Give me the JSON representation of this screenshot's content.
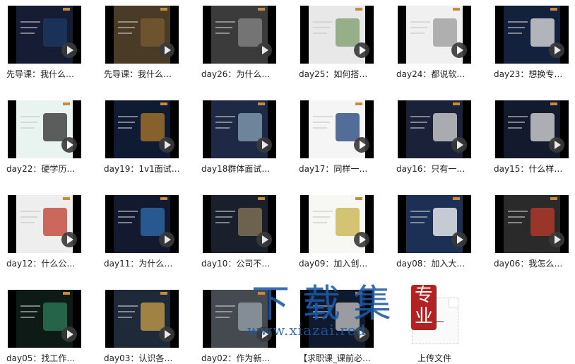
{
  "tiles": [
    {
      "caption": "先导课：我什么…",
      "bg": "#151c33",
      "accent": "#1c3a66"
    },
    {
      "caption": "先导课：我什么…",
      "bg": "#4a3b26",
      "accent": "#7a5c32"
    },
    {
      "caption": "day26：为什么…",
      "bg": "#3b3b3b",
      "accent": "#888888"
    },
    {
      "caption": "day25：如何搭…",
      "bg": "#e8e8e8",
      "accent": "#7b9c6a"
    },
    {
      "caption": "day24：都说软…",
      "bg": "#f0f0f0",
      "accent": "#999999"
    },
    {
      "caption": "day23：想换专…",
      "bg": "#14213d",
      "accent": "#e5e5e5"
    },
    {
      "caption": "day22：硬学历…",
      "bg": "#e9f3f0",
      "accent": "#2b2b2b"
    },
    {
      "caption": "day19：1v1面试…",
      "bg": "#0f1a33",
      "accent": "#b07a2a"
    },
    {
      "caption": "day18群体面试…",
      "bg": "#1e2a45",
      "accent": "#8aa3b8"
    },
    {
      "caption": "day17：同样一…",
      "bg": "#f5f5f5",
      "accent": "#1c3f7a"
    },
    {
      "caption": "day16：只有一…",
      "bg": "#1a2138",
      "accent": "#d9d9d9"
    },
    {
      "caption": "day15：什么样…",
      "bg": "#141a2e",
      "accent": "#e0e0e0"
    },
    {
      "caption": "day12：什么公…",
      "bg": "#eeeeee",
      "accent": "#c0392b"
    },
    {
      "caption": "day11：为什么…",
      "bg": "#131a2f",
      "accent": "#2f6fb2"
    },
    {
      "caption": "day10：公司不…",
      "bg": "#1a1f2c",
      "accent": "#8a7a5a"
    },
    {
      "caption": "day09：加入创…",
      "bg": "#f7f7f4",
      "accent": "#c9b24a"
    },
    {
      "caption": "day08：加入大…",
      "bg": "#1c2f55",
      "accent": "#ffffff"
    },
    {
      "caption": "day06：我怎么…",
      "bg": "#2a2a2a",
      "accent": "#c0392b"
    },
    {
      "caption": "day05：找工作…",
      "bg": "#0d1a16",
      "accent": "#2e7d5b"
    },
    {
      "caption": "day03：认识各…",
      "bg": "#1e2a3a",
      "accent": "#c9a24a"
    },
    {
      "caption": "day02：作为新…",
      "bg": "#444a50",
      "accent": "#9aa4ad"
    },
    {
      "caption": "【求职课_课前必…",
      "bg": "#101a2e",
      "accent": "#c8c8c8"
    }
  ],
  "upload_caption": "上传文件",
  "watermark": {
    "title": "下载集",
    "url": "www.xiazai.red",
    "seal": "专业"
  }
}
